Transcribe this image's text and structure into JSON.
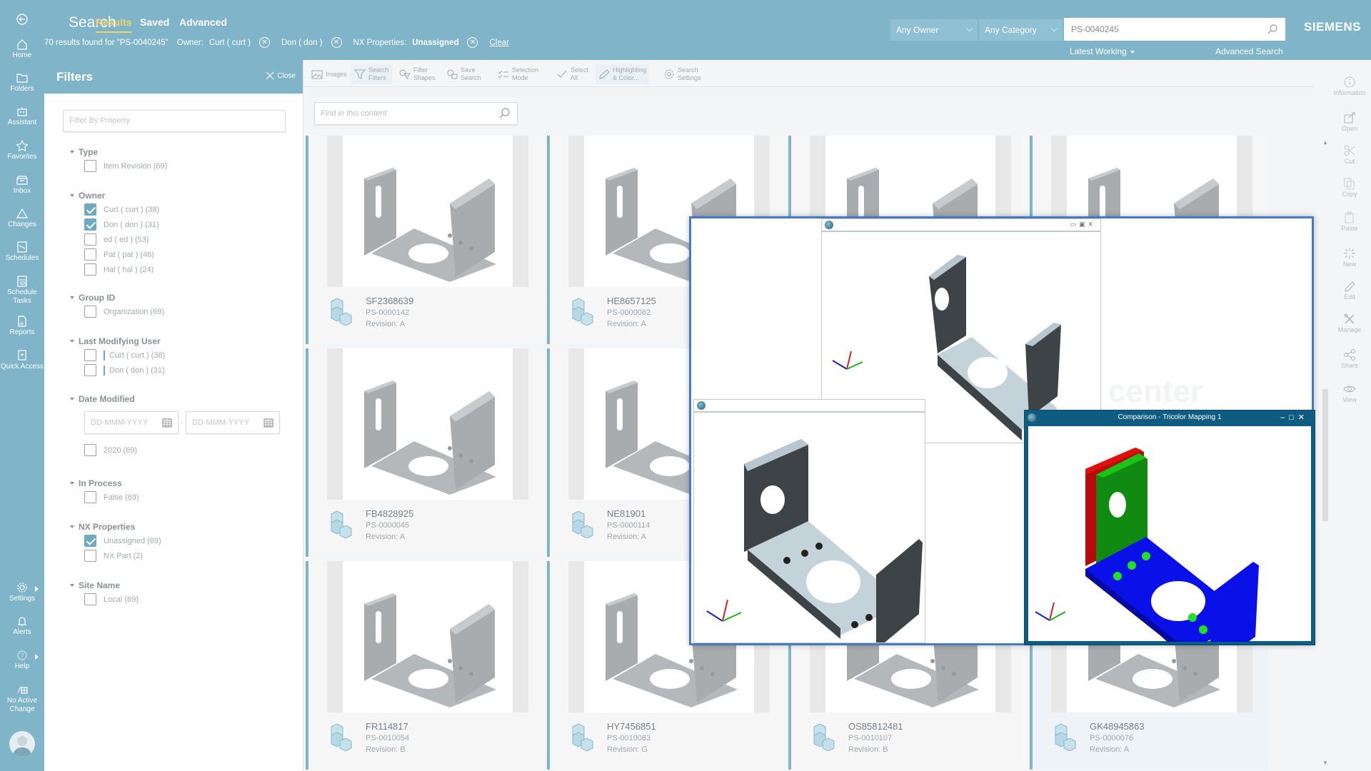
{
  "leftnav": {
    "items": [
      {
        "label": "Home",
        "icon": "home-icon"
      },
      {
        "label": "Folders",
        "icon": "folder-icon"
      },
      {
        "label": "Assistant",
        "icon": "assistant-icon"
      },
      {
        "label": "Favorites",
        "icon": "star-icon"
      },
      {
        "label": "Inbox",
        "icon": "inbox-icon"
      },
      {
        "label": "Changes",
        "icon": "triangle-icon"
      },
      {
        "label": "Schedules",
        "icon": "schedule-icon"
      },
      {
        "label": "Schedule Tasks",
        "icon": "schedule-tasks-icon"
      },
      {
        "label": "Reports",
        "icon": "report-icon"
      },
      {
        "label": "Quick Access",
        "icon": "quick-access-icon"
      }
    ],
    "bottom": [
      {
        "label": "Settings",
        "icon": "gear-icon"
      },
      {
        "label": "Alerts",
        "icon": "bell-icon"
      },
      {
        "label": "Help",
        "icon": "help-icon"
      },
      {
        "label": "No Active Change",
        "icon": "change-icon"
      }
    ]
  },
  "header": {
    "title": "Search",
    "tabs": [
      {
        "label": "Results",
        "active": true
      },
      {
        "label": "Saved",
        "active": false
      },
      {
        "label": "Advanced",
        "active": false
      }
    ],
    "result_summary": "70 results found for \"PS-0040245\"",
    "owner_label": "Owner:",
    "owner_chips": [
      "Curt ( curt )",
      "Don ( don )"
    ],
    "nx_label": "NX Properties:",
    "nx_chip": "Unassigned",
    "clear_label": "Clear",
    "owner_dropdown": "Any Owner",
    "category_dropdown": "Any Category",
    "search_value": "PS-0040245",
    "revision_rule": "Latest Working",
    "advanced_search": "Advanced Search",
    "brand": "SIEMENS"
  },
  "filters": {
    "title": "Filters",
    "close_label": "Close",
    "filter_placeholder": "Filter By Property",
    "groups": [
      {
        "title": "Type",
        "items": [
          {
            "label": "Item Revision  (69)",
            "checked": false
          }
        ]
      },
      {
        "title": "Owner",
        "items": [
          {
            "label": "Curt ( curt )  (38)",
            "checked": true
          },
          {
            "label": "Don ( don )  (31)",
            "checked": true
          },
          {
            "label": "ed ( ed )  (53)",
            "checked": false
          },
          {
            "label": "Pat ( pat )  (46)",
            "checked": false
          },
          {
            "label": "Hal ( hal )  (24)",
            "checked": false
          }
        ]
      },
      {
        "title": "Group ID",
        "items": [
          {
            "label": "Organization  (69)",
            "checked": false
          }
        ]
      },
      {
        "title": "Last Modifying User",
        "items": [
          {
            "label": "Curt ( curt )  (38)",
            "checked": false
          },
          {
            "label": "Don ( don )  (31)",
            "checked": false
          }
        ]
      },
      {
        "title": "Date Modified",
        "date_from_placeholder": "DD-MMM-YYYY",
        "date_to_placeholder": "DD-MMM-YYYY",
        "items": [
          {
            "label": "2020  (69)",
            "checked": false
          }
        ]
      },
      {
        "title": "In Process",
        "items": [
          {
            "label": "False  (69)",
            "checked": false
          }
        ]
      },
      {
        "title": "NX Properties",
        "items": [
          {
            "label": "Unassigned  (69)",
            "checked": true
          },
          {
            "label": "NX Part  (2)",
            "checked": false
          }
        ]
      },
      {
        "title": "Site Name",
        "items": [
          {
            "label": "Local  (69)",
            "checked": false
          }
        ]
      }
    ]
  },
  "toolbar": {
    "items": [
      {
        "l1": "Images",
        "l2": "",
        "icon": "image-icon"
      },
      {
        "l1": "Search",
        "l2": "Filters",
        "icon": "funnel-icon"
      },
      {
        "l1": "Filter",
        "l2": "Shapes",
        "icon": "filter-shapes-icon"
      },
      {
        "l1": "Save",
        "l2": "Search",
        "icon": "save-search-icon"
      },
      {
        "l1": "Selection",
        "l2": "Mode",
        "icon": "selection-mode-icon"
      },
      {
        "l1": "Select",
        "l2": "All",
        "icon": "checkmark-icon"
      },
      {
        "l1": "Highlighting",
        "l2": "& Color...",
        "icon": "pencil-icon"
      },
      {
        "l1": "Search",
        "l2": "Settings",
        "icon": "gear-icon"
      }
    ],
    "find_placeholder": "Find in this content"
  },
  "results": [
    {
      "name": "SF2368639",
      "id": "PS-0000142",
      "revision": "Revision:  A"
    },
    {
      "name": "HE8657125",
      "id": "PS-0000082",
      "revision": "Revision:  A"
    },
    {
      "name": "",
      "id": "",
      "revision": ""
    },
    {
      "name": "",
      "id": "",
      "revision": ""
    },
    {
      "name": "FB4828925",
      "id": "PS-0000045",
      "revision": "Revision:  A"
    },
    {
      "name": "NE81901",
      "id": "PS-0000114",
      "revision": "Revision:  A"
    },
    {
      "name": "",
      "id": "",
      "revision": ""
    },
    {
      "name": "",
      "id": "",
      "revision": ""
    },
    {
      "name": "FR114817",
      "id": "PS-0010054",
      "revision": "Revision:  B"
    },
    {
      "name": "HY7456851",
      "id": "PS-0010083",
      "revision": "Revision:  G"
    },
    {
      "name": "OS85812481",
      "id": "PS-0010107",
      "revision": "Revision:  B"
    },
    {
      "name": "GK48945863",
      "id": "PS-0000076",
      "revision": "Revision:  A"
    }
  ],
  "rightrail": {
    "items": [
      {
        "label": "Information",
        "icon": "info-icon"
      },
      {
        "label": "Open",
        "icon": "open-icon"
      },
      {
        "label": "Cut",
        "icon": "scissors-icon"
      },
      {
        "label": "Copy",
        "icon": "copy-icon"
      },
      {
        "label": "Paste",
        "icon": "paste-icon"
      },
      {
        "label": "New",
        "icon": "new-icon"
      },
      {
        "label": "Edit",
        "icon": "pencil-icon"
      },
      {
        "label": "Manage",
        "icon": "tools-icon"
      },
      {
        "label": "Share",
        "icon": "share-icon"
      },
      {
        "label": "View",
        "icon": "eye-icon"
      }
    ]
  },
  "viewer": {
    "comparison_title": "Comparison - Tricolor Mapping 1",
    "watermark": "center",
    "colors": {
      "red": "#e01010",
      "green": "#14b014",
      "blue": "#0a10e8",
      "frame": "#4a79c4",
      "title_bar": "#0e5c82"
    }
  },
  "colors": {
    "accent": "#7fb4c9",
    "active_tab": "#f2d36b"
  }
}
